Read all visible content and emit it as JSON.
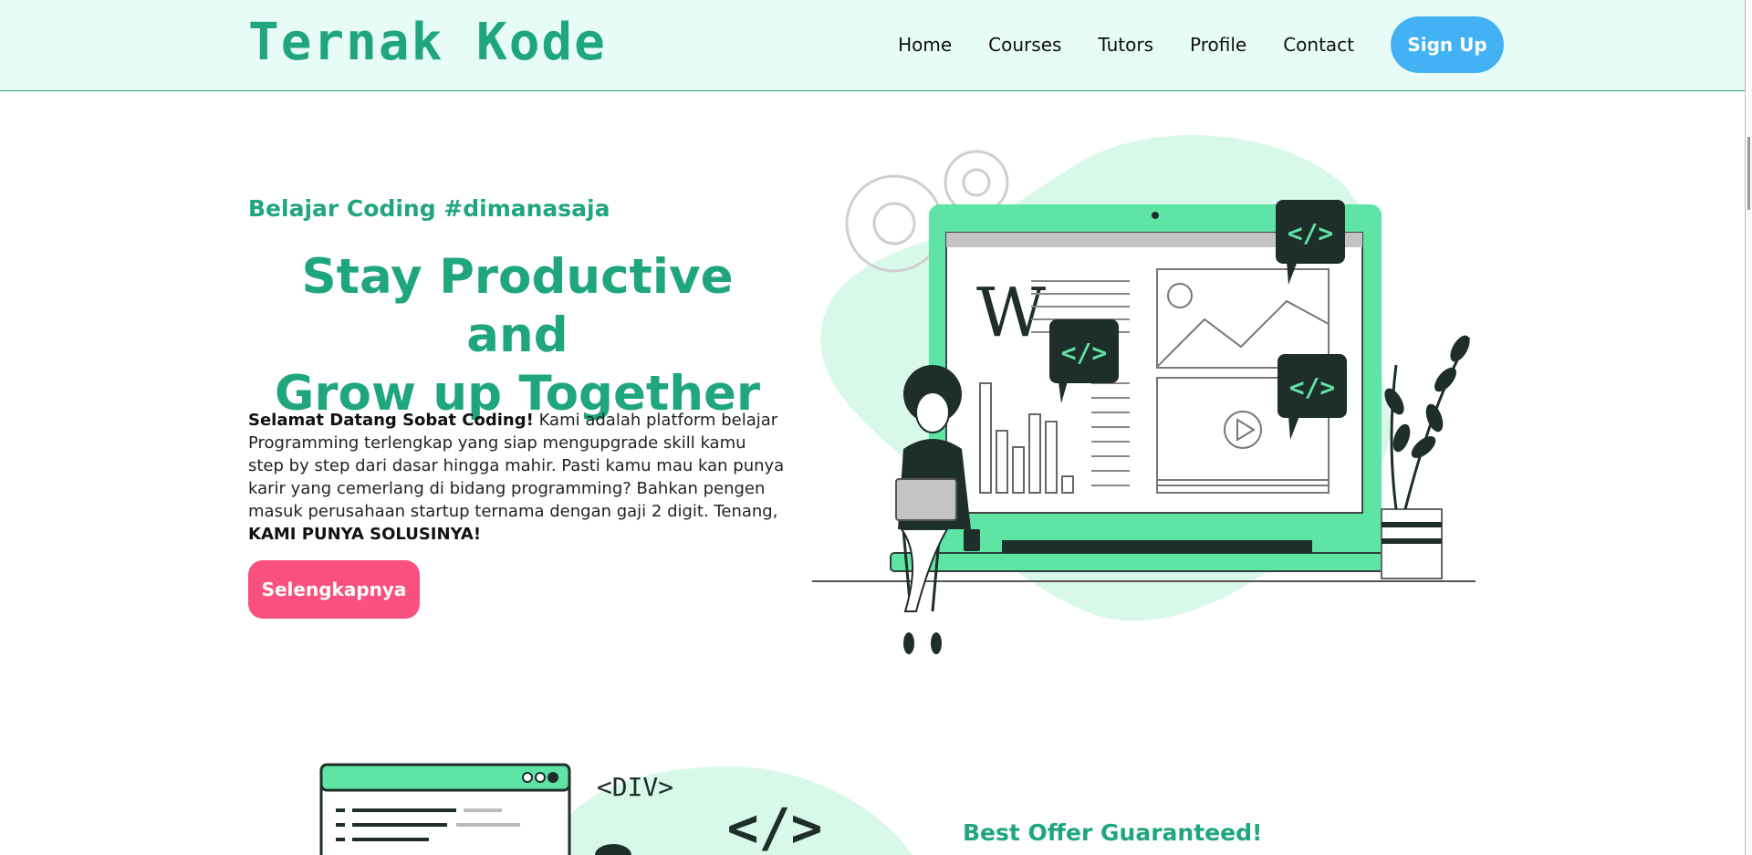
{
  "brand": {
    "name": "Ternak Kode",
    "accent": "#1fa67f",
    "header_bg": "#e8fcf7"
  },
  "nav": {
    "items": [
      {
        "label": "Home"
      },
      {
        "label": "Courses"
      },
      {
        "label": "Tutors"
      },
      {
        "label": "Profile"
      },
      {
        "label": "Contact"
      }
    ],
    "signup_label": "Sign Up",
    "signup_color": "#43b2f4"
  },
  "hero": {
    "tagline": "Belajar Coding #dimanasaja",
    "headline_line1": "Stay Productive and",
    "headline_line2": "Grow up Together",
    "intro_bold": "Selamat Datang Sobat Coding!",
    "intro_body": " Kami adalah platform belajar Programming terlengkap yang siap mengupgrade skill kamu step by step dari dasar hingga mahir. Pasti kamu mau kan punya karir yang cemerlang di bidang programming? Bahkan pengen masuk perusahaan startup ternama dengan gaji 2 digit. Tenang, ",
    "intro_strong_end": "KAMI PUNYA SOLUSINYA!",
    "cta_label": "Selengkapnya",
    "cta_color": "#f9507f",
    "illustration": {
      "monitor_letter": "W",
      "code_tag": "</>"
    }
  },
  "section2": {
    "title": "Best Offer Guaranteed!",
    "illustration": {
      "div_tag": "<DIV>",
      "code_tag": "</>"
    }
  }
}
